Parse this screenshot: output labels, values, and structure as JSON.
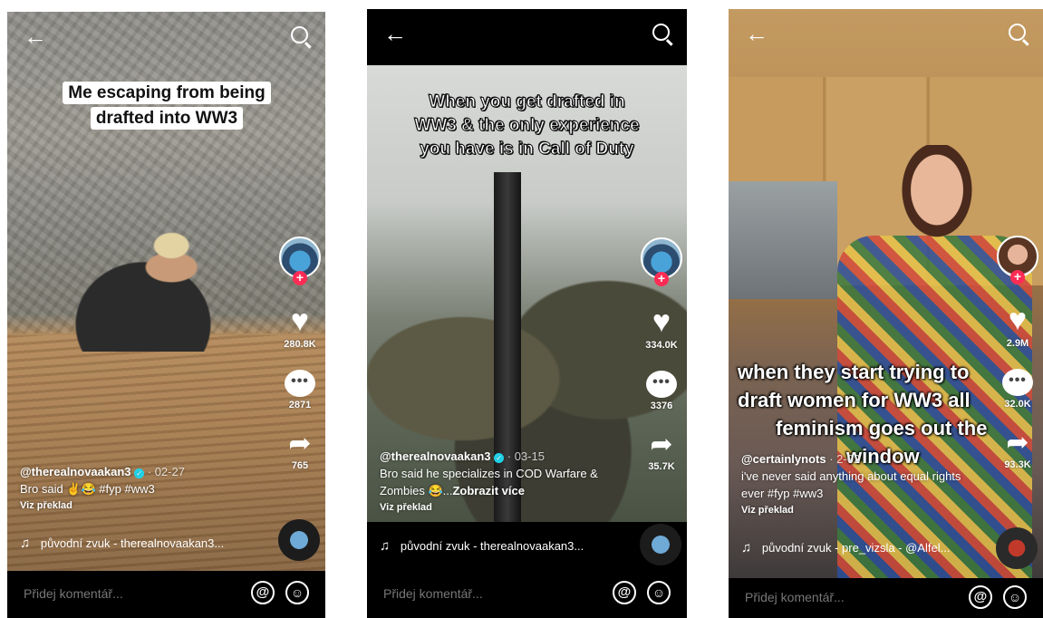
{
  "common": {
    "back_icon": "arrow-left-icon",
    "search_icon": "search-icon",
    "comment_placeholder": "Přidej komentář...",
    "at_symbol": "@",
    "plus_symbol": "+",
    "note_symbol": "♫",
    "translate_label": "Viz překlad"
  },
  "videos": [
    {
      "caption_lines": [
        "Me escaping from being",
        "drafted into WW3"
      ],
      "username": "@therealnovaakan3",
      "date": "· 02-27",
      "description": "Bro said ✌️😂 #fyp #ww3",
      "description_more": "",
      "likes": "280.8K",
      "comments": "2871",
      "shares": "765",
      "sound": "původní zvuk - therealnovaakan3..."
    },
    {
      "caption_lines": [
        "When you get drafted in",
        "WW3 & the only experience",
        "you have is in Call of Duty"
      ],
      "username": "@therealnovaakan3",
      "date": "· 03-15",
      "description": "Bro said he specializes in COD Warfare & Zombies 😂...",
      "description_more": "Zobrazit více",
      "likes": "334.0K",
      "comments": "3376",
      "shares": "35.7K",
      "sound": "původní zvuk - therealnovaakan3..."
    },
    {
      "caption_lines": [
        "when they start trying to",
        "draft women for WW3 all",
        "feminism goes out the",
        "window"
      ],
      "username": "@certainlynots",
      "date": "· 2-02",
      "description": "i've never said anything about equal rights ever #fyp #ww3",
      "description_more": "",
      "likes": "2.9M",
      "comments": "32.0K",
      "shares": "93.3K",
      "sound": "původní zvuk - pre_vizsla - @Alfel..."
    }
  ]
}
